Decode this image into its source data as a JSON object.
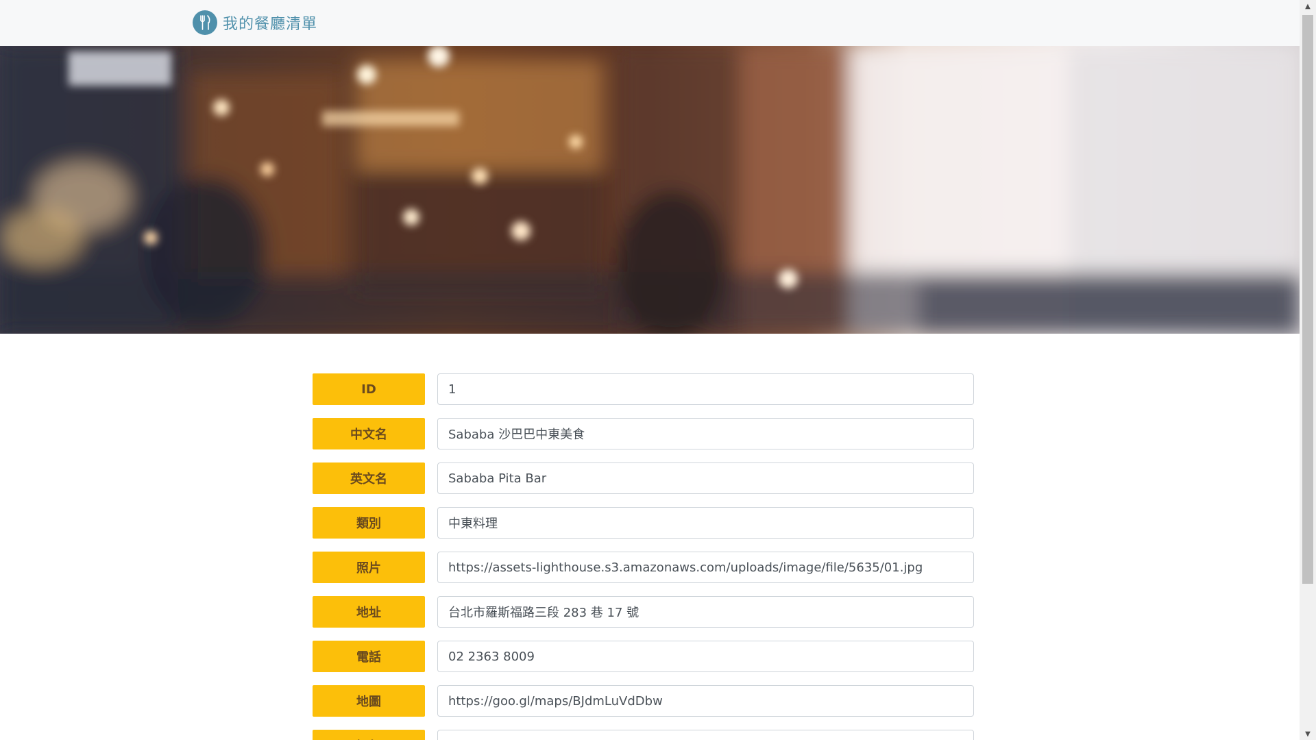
{
  "navbar": {
    "brand_label": "我的餐廳清單",
    "brand_icon": "utensils-icon"
  },
  "banner": {
    "description_icon": "restaurant-banner-image"
  },
  "form": {
    "fields": [
      {
        "label": "ID",
        "value": "1"
      },
      {
        "label": "中文名",
        "value": "Sababa 沙巴巴中東美食"
      },
      {
        "label": "英文名",
        "value": "Sababa Pita Bar"
      },
      {
        "label": "類別",
        "value": "中東料理"
      },
      {
        "label": "照片",
        "value": "https://assets-lighthouse.s3.amazonaws.com/uploads/image/file/5635/01.jpg"
      },
      {
        "label": "地址",
        "value": "台北市羅斯福路三段 283 巷 17 號"
      },
      {
        "label": "電話",
        "value": "02 2363 8009"
      },
      {
        "label": "地圖",
        "value": "https://goo.gl/maps/BJdmLuVdDbw"
      },
      {
        "label": "評価",
        "value": ""
      }
    ]
  },
  "colors": {
    "label_bg": "#fcbf0a",
    "brand": "#4f90ab",
    "navbar_bg": "#f7f8f9"
  }
}
